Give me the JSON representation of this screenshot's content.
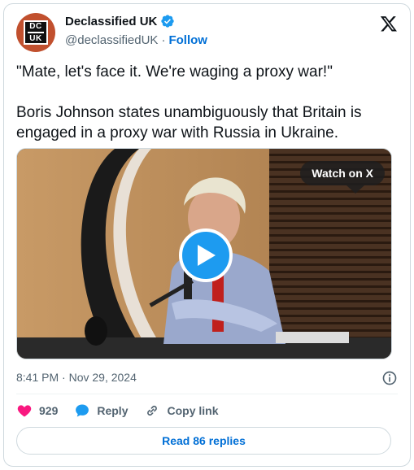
{
  "author": {
    "display_name": "Declassified UK",
    "handle": "@declassifiedUK",
    "separator": "·",
    "follow_label": "Follow",
    "avatar_text_top": "DC",
    "avatar_text_bottom": "UK",
    "avatar_color": "#c1502e"
  },
  "tweet": {
    "quote": "\"Mate, let's face it. We're waging a proxy war!\"",
    "body": "Boris Johnson states unambiguously that Britain is engaged in a proxy war with Russia in Ukraine."
  },
  "media": {
    "watch_label": "Watch on X",
    "play_icon": "play-icon"
  },
  "meta": {
    "timestamp": "8:41 PM · Nov 29, 2024"
  },
  "actions": {
    "likes": "929",
    "reply_label": "Reply",
    "copy_label": "Copy link"
  },
  "footer": {
    "read_replies": "Read 86 replies"
  },
  "colors": {
    "accent": "#1d9bf0",
    "link": "#006fd6",
    "like": "#f91880",
    "muted": "#536471"
  }
}
